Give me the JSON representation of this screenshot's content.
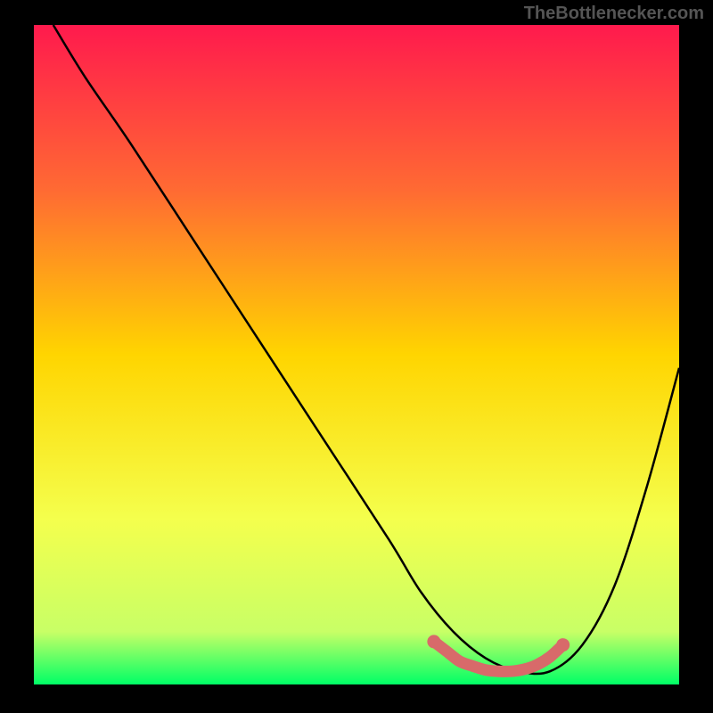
{
  "watermark": "TheBottlenecker.com",
  "chart_data": {
    "type": "line",
    "title": "",
    "xlabel": "",
    "ylabel": "",
    "xlim": [
      0,
      100
    ],
    "ylim": [
      0,
      100
    ],
    "gradient_stops": [
      {
        "offset": 0,
        "color": "#ff1a4d"
      },
      {
        "offset": 25,
        "color": "#ff6a33"
      },
      {
        "offset": 50,
        "color": "#ffd500"
      },
      {
        "offset": 75,
        "color": "#f4ff4d"
      },
      {
        "offset": 92,
        "color": "#c8ff66"
      },
      {
        "offset": 100,
        "color": "#00ff66"
      }
    ],
    "series": [
      {
        "name": "curve",
        "color": "#000000",
        "x": [
          3,
          8,
          15,
          25,
          35,
          45,
          55,
          60,
          65,
          70,
          75,
          80,
          85,
          90,
          95,
          100
        ],
        "y": [
          100,
          92,
          82,
          67,
          52,
          37,
          22,
          14,
          8,
          4,
          2,
          2,
          6,
          15,
          30,
          48
        ]
      }
    ],
    "highlight_band": {
      "color": "#d86a6a",
      "x": [
        62,
        64,
        66,
        68,
        70,
        72,
        74,
        76,
        78,
        80,
        82
      ],
      "y": [
        6.5,
        5,
        3.5,
        2.8,
        2.2,
        2,
        2,
        2.3,
        3,
        4.2,
        6
      ]
    }
  }
}
